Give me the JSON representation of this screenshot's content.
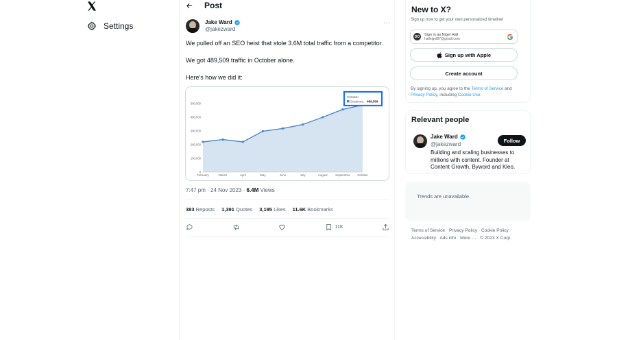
{
  "nav": {
    "logo_icon": "x-logo-icon",
    "settings_label": "Settings"
  },
  "post": {
    "header_title": "Post",
    "author_name": "Jake Ward",
    "author_handle": "@jakezward",
    "text_lines": [
      "We pulled off an SEO heist that stole 3.6M total traffic from a competitor.",
      "We got 489,509 traffic in October alone.",
      "Here's how we did it:"
    ],
    "timestamp": "7:47 pm · 24 Nov 2023 · ",
    "views_count": "6.4M",
    "views_label": " Views",
    "stats": {
      "reposts_count": "383",
      "reposts_label": "Reposts",
      "quotes_count": "1,391",
      "quotes_label": "Quotes",
      "likes_count": "3,195",
      "likes_label": "Likes",
      "bookmarks_count": "11.6K",
      "bookmarks_label": "Bookmarks"
    },
    "bookmark_count_action": "11K"
  },
  "chart_data": {
    "type": "area",
    "categories": [
      "February",
      "March",
      "April",
      "May",
      "June",
      "July",
      "August",
      "September",
      "October"
    ],
    "values": [
      220000,
      237000,
      220000,
      298000,
      318000,
      347000,
      400000,
      457000,
      489509
    ],
    "ylim": [
      0,
      500000
    ],
    "yticks": [
      "0",
      "100,000",
      "200,000",
      "300,000",
      "400,000",
      "500,000"
    ],
    "tooltip": {
      "month": "October",
      "label": "Sessions:",
      "value": "489,509"
    },
    "colors": {
      "line": "#4d86c7",
      "fill": "#d6e4f2",
      "highlight": "#1a73e8"
    }
  },
  "sidebar": {
    "new_title": "New to X?",
    "new_sub": "Sign up now to get your own personalized timeline!",
    "google_line1": "Sign in as Nigel Hall",
    "google_line2": "hallnigel87@gmail.com",
    "google_avatar": "DO",
    "apple_label": "Sign up with Apple",
    "create_label": "Create account",
    "terms_pre": "By signing up, you agree to the ",
    "terms_link": "Terms of Service",
    "terms_mid": " and ",
    "privacy_link": "Privacy Policy",
    "terms_mid2": ", including ",
    "cookie_link": "Cookie Use",
    "terms_end": ".",
    "people_title": "Relevant people",
    "person_name": "Jake Ward",
    "person_handle": "@jakezward",
    "person_bio": "Building and scaling businesses to millions with content. Founder at Content Growth, Byword and Kleo.",
    "follow_label": "Follow",
    "trends_text": "Trends are unavailable.",
    "footer": [
      "Terms of Service",
      "Privacy Policy",
      "Cookie Policy",
      "Accessibility",
      "Ads info",
      "More ···",
      "© 2023 X Corp."
    ]
  }
}
